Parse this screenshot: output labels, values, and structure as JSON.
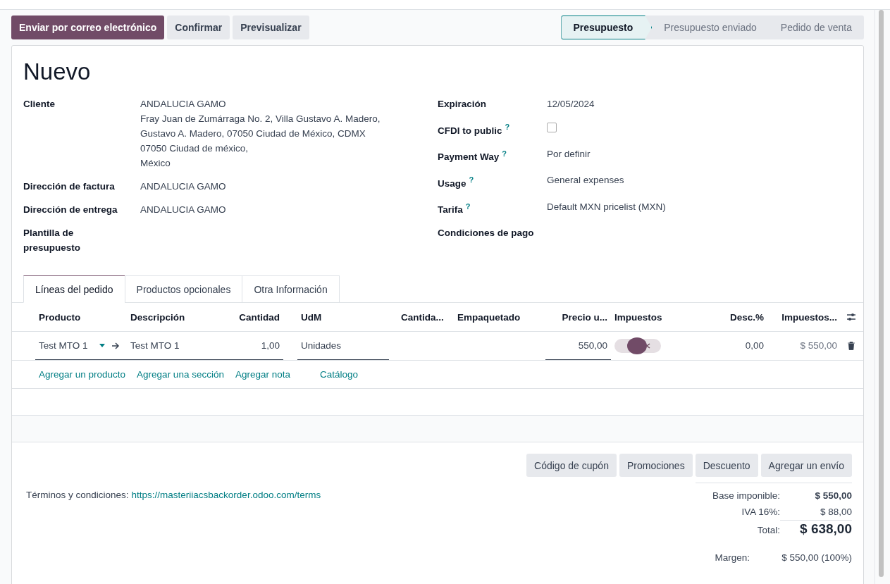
{
  "actions": [
    {
      "label": "Enviar por correo electrónico",
      "kind": "primary"
    },
    {
      "label": "Confirmar",
      "kind": "secondary"
    },
    {
      "label": "Previsualizar",
      "kind": "secondary"
    }
  ],
  "status_steps": [
    {
      "label": "Presupuesto",
      "selected": true
    },
    {
      "label": "Presupuesto enviado",
      "selected": false
    },
    {
      "label": "Pedido de venta",
      "selected": false
    }
  ],
  "title": "Nuevo",
  "left_fields": [
    {
      "label": "Cliente",
      "lines": [
        "ANDALUCIA GAMO",
        "Fray Juan de Zumárraga No. 2, Villa Gustavo A. Madero,",
        "Gustavo A. Madero, 07050 Ciudad de México, CDMX",
        "07050 Ciudad de méxico,",
        "México"
      ]
    },
    {
      "label": "Dirección de factura",
      "lines": [
        "ANDALUCIA GAMO"
      ]
    },
    {
      "label": "Dirección de entrega",
      "lines": [
        "ANDALUCIA GAMO"
      ]
    },
    {
      "label": "Plantilla de presupuesto"
    }
  ],
  "right_fields": [
    {
      "label": "Expiración",
      "help": false,
      "kind": "text",
      "value": "12/05/2024"
    },
    {
      "label": "CFDI to public",
      "help": true,
      "kind": "checkbox",
      "checked": false
    },
    {
      "label": "Payment Way",
      "help": true,
      "kind": "text",
      "value": "Por definir"
    },
    {
      "label": "Usage",
      "help": true,
      "kind": "text",
      "value": "General expenses"
    },
    {
      "label": "Tarifa",
      "help": true,
      "kind": "text",
      "value": "Default MXN pricelist (MXN)"
    },
    {
      "label": "Condiciones de pago",
      "help": false,
      "kind": "text"
    }
  ],
  "help_mark": "?",
  "tabs": [
    {
      "label": "Líneas del pedido",
      "selected": true
    },
    {
      "label": "Productos opcionales",
      "selected": false
    },
    {
      "label": "Otra Información",
      "selected": false
    }
  ],
  "table": {
    "columns": [
      "Producto",
      "Descripción",
      "Cantidad",
      "UdM",
      "Cantida...",
      "Empaquetado",
      "Precio u...",
      "Impuestos",
      "Desc.%",
      "Impuestos..."
    ],
    "rows": [
      {
        "producto": "Test MTO 1",
        "descripcion": "Test MTO 1",
        "cantidad": "1,00",
        "udm": "Unidades",
        "precio": "550,00",
        "desc": "0,00",
        "subtotal": "$ 550,00"
      }
    ],
    "add_links": [
      "Agregar un producto",
      "Agregar una sección",
      "Agregar nota",
      "Catálogo"
    ]
  },
  "footer_buttons": [
    "Código de cupón",
    "Promociones",
    "Descuento",
    "Agregar un envío"
  ],
  "terms": {
    "label": "Términos y condiciones:",
    "link": "https://masteriiacsbackorder.odoo.com/terms"
  },
  "totals": [
    {
      "label": "Base imponible:",
      "value": "$ 550,00",
      "kind": "bold"
    },
    {
      "label": "IVA 16%:",
      "value": "$ 88,00",
      "kind": "plain"
    },
    {
      "label": "Total:",
      "value": "$ 638,00",
      "kind": "total"
    }
  ],
  "margin": {
    "label": "Margen:",
    "value": "$ 550,00 (100%)"
  }
}
